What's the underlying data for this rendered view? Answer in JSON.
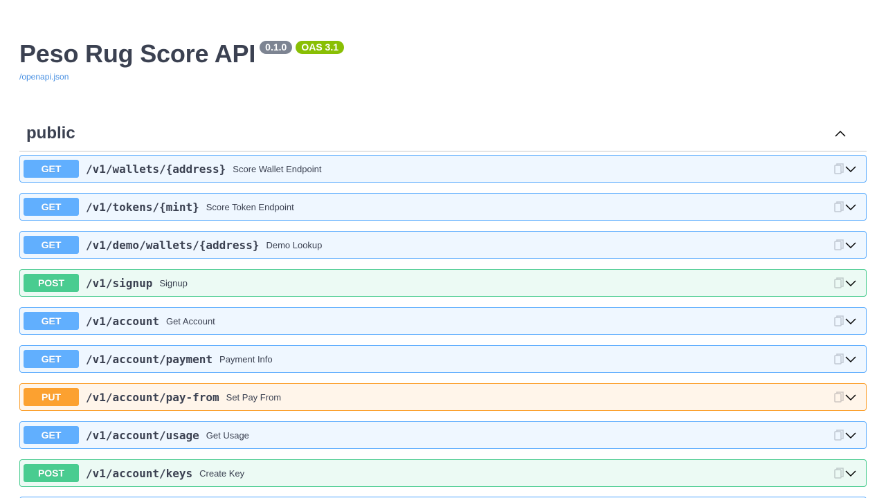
{
  "info": {
    "title": "Peso Rug Score API",
    "version": "0.1.0",
    "oas": "OAS 3.1",
    "spec_link": "/openapi.json"
  },
  "tag": {
    "name": "public"
  },
  "colors": {
    "get": "#61affe",
    "post": "#49cc90",
    "put": "#fca130"
  },
  "operations": [
    {
      "method": "GET",
      "path": "/v1/wallets/{address}",
      "summary": "Score Wallet Endpoint"
    },
    {
      "method": "GET",
      "path": "/v1/tokens/{mint}",
      "summary": "Score Token Endpoint"
    },
    {
      "method": "GET",
      "path": "/v1/demo/wallets/{address}",
      "summary": "Demo Lookup"
    },
    {
      "method": "POST",
      "path": "/v1/signup",
      "summary": "Signup"
    },
    {
      "method": "GET",
      "path": "/v1/account",
      "summary": "Get Account"
    },
    {
      "method": "GET",
      "path": "/v1/account/payment",
      "summary": "Payment Info"
    },
    {
      "method": "PUT",
      "path": "/v1/account/pay-from",
      "summary": "Set Pay From"
    },
    {
      "method": "GET",
      "path": "/v1/account/usage",
      "summary": "Get Usage"
    },
    {
      "method": "POST",
      "path": "/v1/account/keys",
      "summary": "Create Key"
    }
  ]
}
